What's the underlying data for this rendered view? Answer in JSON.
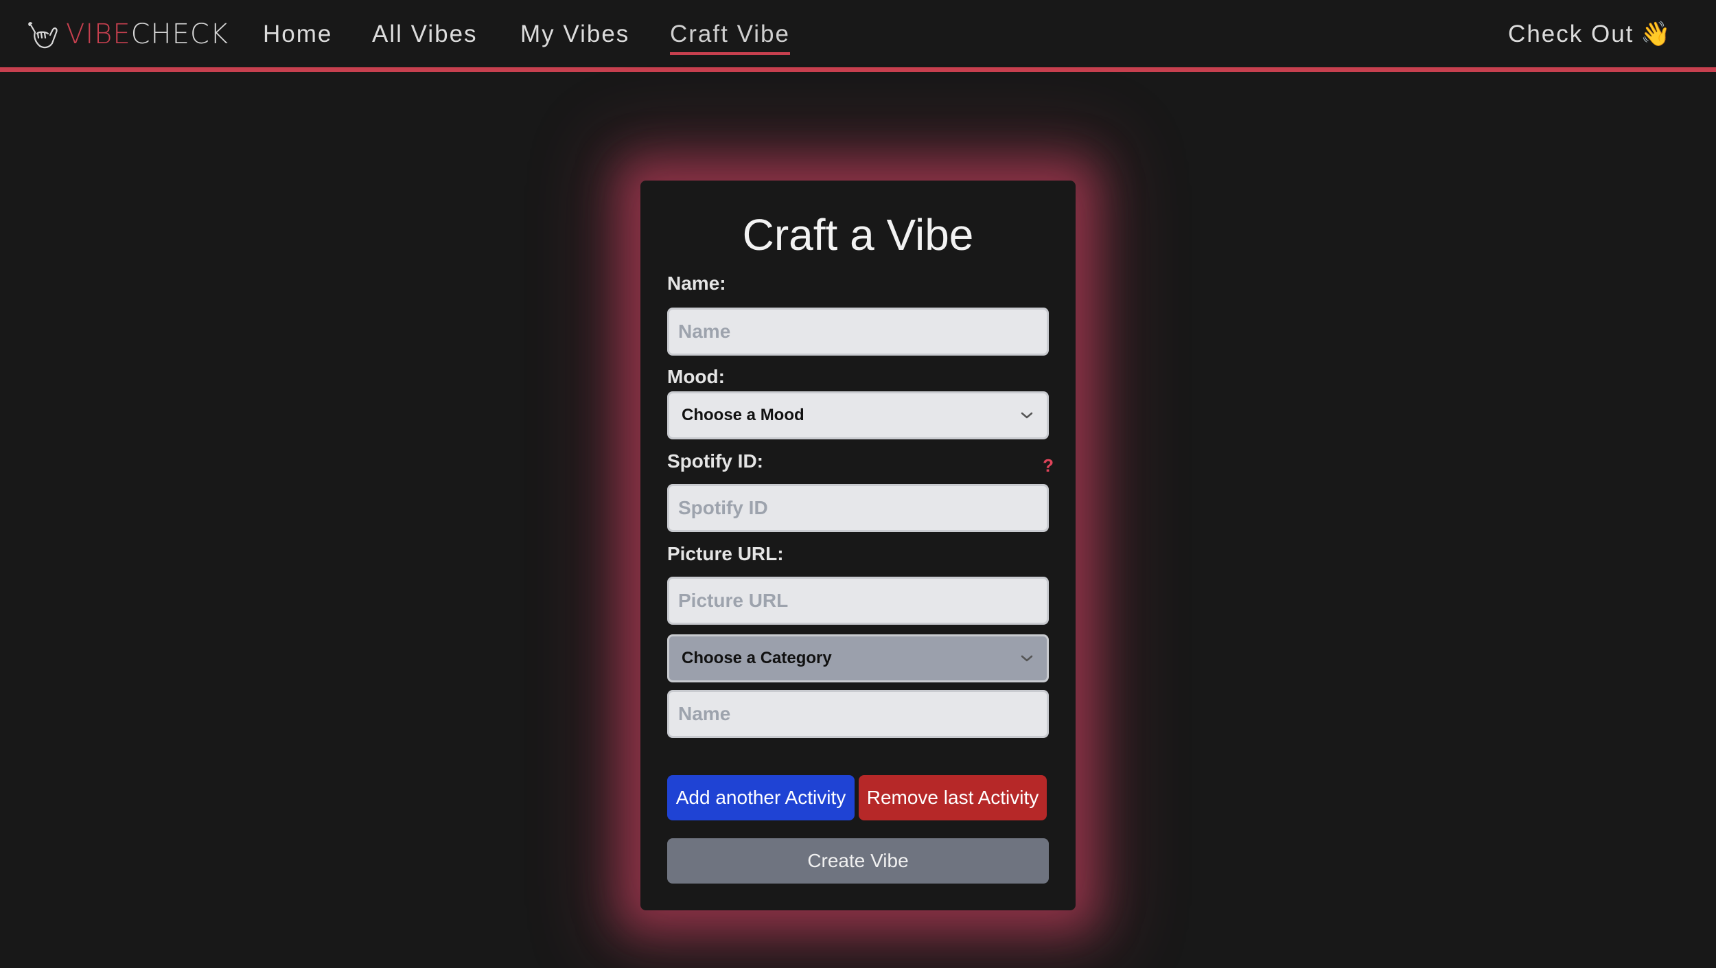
{
  "brand": {
    "part1": "VIBE",
    "part2": "CHECK"
  },
  "nav": {
    "home": "Home",
    "all_vibes": "All Vibes",
    "my_vibes": "My Vibes",
    "craft_vibe": "Craft Vibe",
    "check_out": "Check Out",
    "wave_emoji": "👋"
  },
  "form": {
    "title": "Craft a Vibe",
    "name_label": "Name:",
    "name_placeholder": "Name",
    "mood_label": "Mood:",
    "mood_selected": "Choose a Mood",
    "spotify_label": "Spotify ID:",
    "spotify_help": "?",
    "spotify_placeholder": "Spotify ID",
    "picture_label": "Picture URL:",
    "picture_placeholder": "Picture URL",
    "category_selected": "Choose a Category",
    "activity_placeholder": "Name",
    "add_activity": "Add another Activity",
    "remove_activity": "Remove last Activity",
    "create": "Create Vibe"
  },
  "colors": {
    "accent": "#c7404f",
    "background": "#181818",
    "add_button": "#1f43d4",
    "remove_button": "#b62828",
    "create_button": "#6f7480"
  },
  "icons": {
    "brand": "shaka-hand-icon",
    "select": "chevron-down-icon"
  }
}
